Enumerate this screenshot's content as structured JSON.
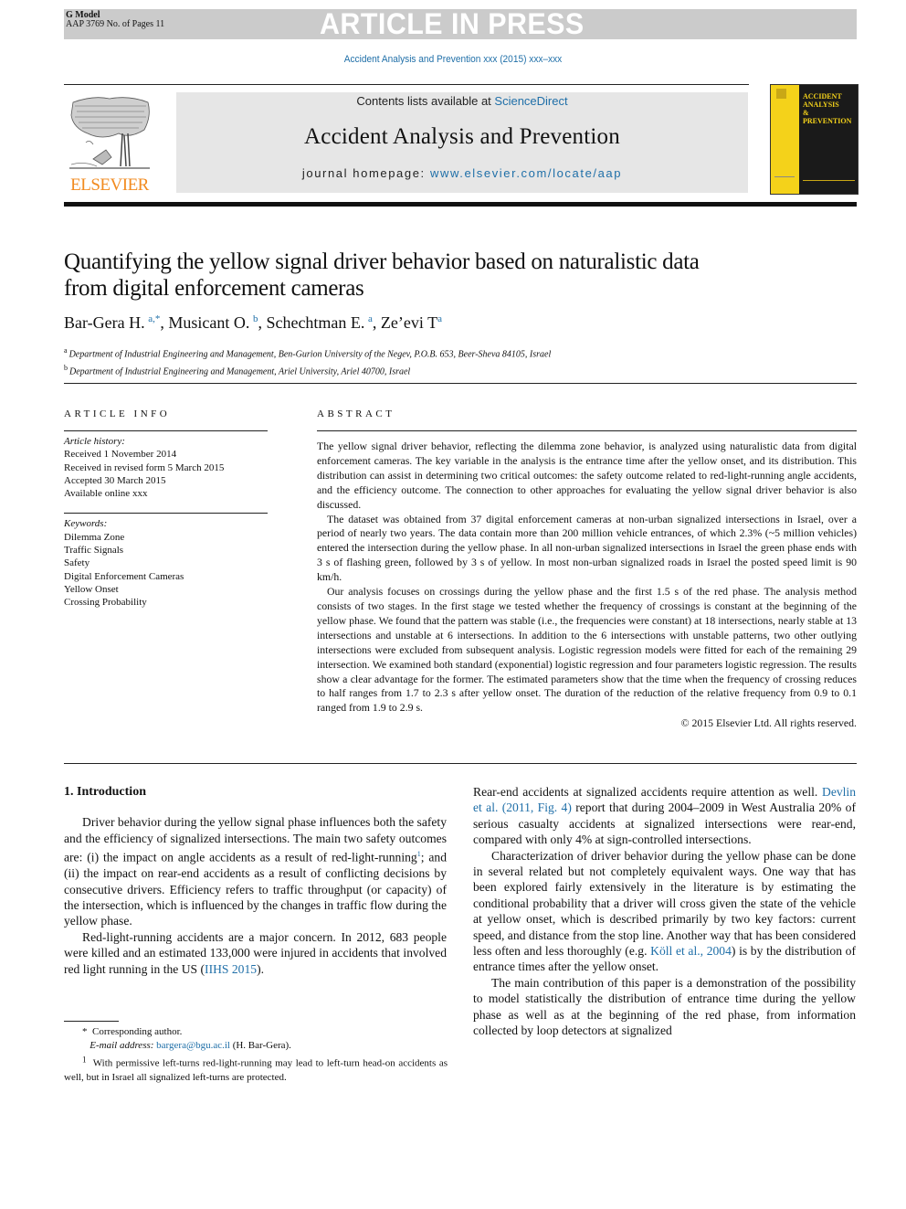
{
  "banner": {
    "model_label": "G Model",
    "article_id": "AAP 3769 No. of Pages 11",
    "status": "ARTICLE IN PRESS"
  },
  "journal_ref": "Accident Analysis and Prevention xxx (2015) xxx–xxx",
  "masthead": {
    "contents_prefix": "Contents lists available at ",
    "contents_link": "ScienceDirect",
    "journal_name": "Accident Analysis and Prevention",
    "homepage_prefix": "journal homepage: ",
    "homepage_link": "www.elsevier.com/locate/aap",
    "publisher_logo_text": "ELSEVIER",
    "cover_title_lines": [
      "ACCIDENT",
      "ANALYSIS",
      "&",
      "PREVENTION"
    ]
  },
  "article": {
    "title_line1": "Quantifying the yellow signal driver behavior based on naturalistic data",
    "title_line2": "from digital enforcement cameras",
    "authors": [
      {
        "name": "Bar-Gera H.",
        "affil": "a,*"
      },
      {
        "name": "Musicant O.",
        "affil": "b"
      },
      {
        "name": "Schechtman E.",
        "affil": "a"
      },
      {
        "name": "Ze’evi T",
        "affil": "a"
      }
    ],
    "affiliations": [
      {
        "mark": "a",
        "text": "Department of Industrial Engineering and Management, Ben-Gurion University of the Negev, P.O.B. 653, Beer-Sheva 84105, Israel"
      },
      {
        "mark": "b",
        "text": "Department of Industrial Engineering and Management, Ariel University, Ariel 40700, Israel"
      }
    ]
  },
  "article_info": {
    "heading": "ARTICLE INFO",
    "history_label": "Article history:",
    "history": [
      "Received 1 November 2014",
      "Received in revised form 5 March 2015",
      "Accepted 30 March 2015",
      "Available online xxx"
    ],
    "keywords_label": "Keywords:",
    "keywords": [
      "Dilemma Zone",
      "Traffic Signals",
      "Safety",
      "Digital Enforcement Cameras",
      "Yellow Onset",
      "Crossing Probability"
    ]
  },
  "abstract": {
    "heading": "ABSTRACT",
    "paragraphs": [
      "The yellow signal driver behavior, reflecting the dilemma zone behavior, is analyzed using naturalistic data from digital enforcement cameras. The key variable in the analysis is the entrance time after the yellow onset, and its distribution. This distribution can assist in determining two critical outcomes: the safety outcome related to red-light-running angle accidents, and the efficiency outcome. The connection to other approaches for evaluating the yellow signal driver behavior is also discussed.",
      "The dataset was obtained from 37 digital enforcement cameras at non-urban signalized intersections in Israel, over a period of nearly two years. The data contain more than 200 million vehicle entrances, of which 2.3% (~5 million vehicles) entered the intersection during the yellow phase. In all non-urban signalized intersections in Israel the green phase ends with 3 s of flashing green, followed by 3 s of yellow. In most non-urban signalized roads in Israel the posted speed limit is 90 km/h.",
      "Our analysis focuses on crossings during the yellow phase and the first 1.5 s of the red phase. The analysis method consists of two stages. In the first stage we tested whether the frequency of crossings is constant at the beginning of the yellow phase. We found that the pattern was stable (i.e., the frequencies were constant) at 18 intersections, nearly stable at 13 intersections and unstable at 6 intersections. In addition to the 6 intersections with unstable patterns, two other outlying intersections were excluded from subsequent analysis. Logistic regression models were fitted for each of the remaining 29 intersection. We examined both standard (exponential) logistic regression and four parameters logistic regression. The results show a clear advantage for the former. The estimated parameters show that the time when the frequency of crossing reduces to half ranges from 1.7 to 2.3 s after yellow onset. The duration of the reduction of the relative frequency from 0.9 to 0.1 ranged from 1.9 to 2.9 s."
    ],
    "copyright": "© 2015 Elsevier Ltd. All rights reserved."
  },
  "body": {
    "section_heading": "1. Introduction",
    "left": {
      "p1_before_fn": "Driver behavior during the yellow signal phase influences both the safety and the efficiency of signalized intersections. The main two safety outcomes are: (i) the impact on angle accidents as a result of red-light-running",
      "p1_fn_mark": "1",
      "p1_after_fn": "; and (ii) the impact on rear-end accidents as a result of conflicting decisions by consecutive drivers. Efficiency refers to traffic throughput (or capacity) of the intersection, which is influenced by the changes in traffic flow during the yellow phase.",
      "p2_before_link": "Red-light-running accidents are a major concern. In 2012, 683 people were killed and an estimated 133,000 were injured in accidents that involved red light running in the US (",
      "p2_link": "IIHS 2015",
      "p2_after_link": ")."
    },
    "right": {
      "p1_before_link": "Rear-end accidents at signalized accidents require attention as well. ",
      "p1_link": "Devlin et al. (2011, Fig. 4)",
      "p1_after_link": " report that during 2004–2009 in West Australia 20% of serious casualty accidents at signalized intersections were rear-end, compared with only 4% at sign-controlled intersections.",
      "p2_before_link": "Characterization of driver behavior during the yellow phase can be done in several related but not completely equivalent ways. One way that has been explored fairly extensively in the literature is by estimating the conditional probability that a driver will cross given the state of the vehicle at yellow onset, which is described primarily by two key factors: current speed, and distance from the stop line. Another way that has been considered less often and less thoroughly (e.g. ",
      "p2_link": "Köll et al., 2004",
      "p2_after_link": ") is by the distribution of entrance times after the yellow onset.",
      "p3": "The main contribution of this paper is a demonstration of the possibility to model statistically the distribution of entrance time during the yellow phase as well as at the beginning of the red phase, from information collected by loop detectors at signalized"
    }
  },
  "footnotes": {
    "corresponding_mark": "*",
    "corresponding": "Corresponding author.",
    "email_label": "E-mail address:",
    "email": "bargera@bgu.ac.il",
    "email_owner": "(H.  Bar-Gera).",
    "fn1_mark": "1",
    "fn1": "With permissive left-turns red-light-running may lead to left-turn head-on accidents as well, but in Israel all signalized left-turns are protected."
  },
  "colors": {
    "link": "#1f6fa8",
    "banner_gray": "#cbcbcb",
    "masthead_gray": "#e6e6e6",
    "elsevier_orange": "#f28b20",
    "cover_yellow": "#f4d21a"
  }
}
